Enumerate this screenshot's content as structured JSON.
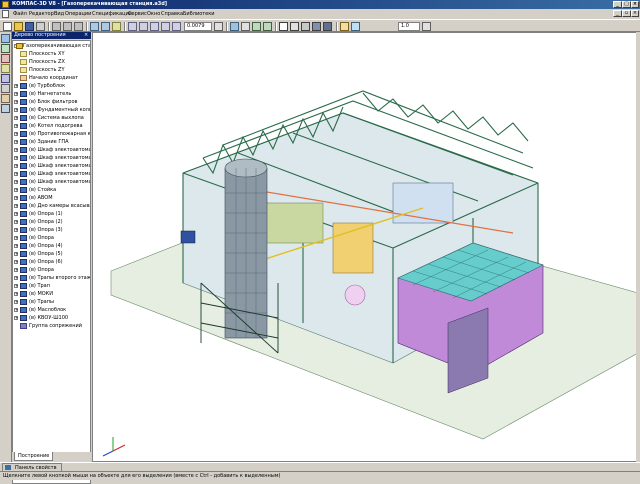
{
  "window": {
    "title": "КОМПАС-3D V8 - [Газоперекачивающая станция.a3d]"
  },
  "menu": [
    "Файл",
    "Редактор",
    "Вид",
    "Операции",
    "Спецификация",
    "Сервис",
    "Окно",
    "Справка",
    "Библиотеки"
  ],
  "toolbar": {
    "scale_value": "0.0079",
    "step_value": "1.0"
  },
  "tree": {
    "header": "Дерево построения",
    "tab": "Построение",
    "items": [
      {
        "label": "Газоперекачивающая станция",
        "type": "root"
      },
      {
        "label": "Плоскость XY",
        "type": "plane"
      },
      {
        "label": "Плоскость ZX",
        "type": "plane"
      },
      {
        "label": "Плоскость ZY",
        "type": "plane"
      },
      {
        "label": "Начало координат",
        "type": "origin"
      },
      {
        "label": "(в) Турбоблок",
        "type": "part"
      },
      {
        "label": "(в) Нагнетатель",
        "type": "part"
      },
      {
        "label": "(в) Блок фильтров",
        "type": "part"
      },
      {
        "label": "(в) Фундаментный кольц",
        "type": "part"
      },
      {
        "label": "(в) Система выхлопа",
        "type": "part"
      },
      {
        "label": "(в) Котел подогрева",
        "type": "part"
      },
      {
        "label": "(в) Противопожарная крыш",
        "type": "part"
      },
      {
        "label": "(в) Здание ГПА",
        "type": "part"
      },
      {
        "label": "(в) Шкаф электоавтоматики (1)",
        "type": "part"
      },
      {
        "label": "(в) Шкаф электоавтоматики (2)",
        "type": "part"
      },
      {
        "label": "(в) Шкаф электоавтоматики (3)",
        "type": "part"
      },
      {
        "label": "(в) Шкаф электоавтоматики (4)",
        "type": "part"
      },
      {
        "label": "(в) Шкаф электоавтоматики (5)",
        "type": "part"
      },
      {
        "label": "(в) Стойка",
        "type": "part"
      },
      {
        "label": "(в) АВОМ",
        "type": "part"
      },
      {
        "label": "(в) Дно камеры всасывания",
        "type": "part"
      },
      {
        "label": "(в) Опора (1)",
        "type": "part"
      },
      {
        "label": "(в) Опора (2)",
        "type": "part"
      },
      {
        "label": "(в) Опора (3)",
        "type": "part"
      },
      {
        "label": "(в) Опора",
        "type": "part"
      },
      {
        "label": "(в) Опора (4)",
        "type": "part"
      },
      {
        "label": "(в) Опора (5)",
        "type": "part"
      },
      {
        "label": "(в) Опора (6)",
        "type": "part"
      },
      {
        "label": "(в) Опора",
        "type": "part"
      },
      {
        "label": "(в) Трапы второго этажа",
        "type": "part"
      },
      {
        "label": "(в) Трап",
        "type": "part"
      },
      {
        "label": "(в) МОКИ",
        "type": "part"
      },
      {
        "label": "(в) Трапы",
        "type": "part"
      },
      {
        "label": "(в) Маслоблок",
        "type": "part"
      },
      {
        "label": "(в) КВОУ-Ш100",
        "type": "part"
      },
      {
        "label": "Группа сопряжений",
        "type": "group"
      }
    ]
  },
  "props_panel": {
    "label": "Панель свойств"
  },
  "status": {
    "text": "Щелкните левой кнопкой мыши на объекте для его выделения (вместе с Ctrl - добавить к выделенным)"
  },
  "colors": {
    "title_bar": "#0a246a",
    "chrome": "#d4d0c8",
    "structure_green": "#2a6a4a",
    "roof_cyan": "#66cccc",
    "accent_purple": "#9933cc"
  }
}
